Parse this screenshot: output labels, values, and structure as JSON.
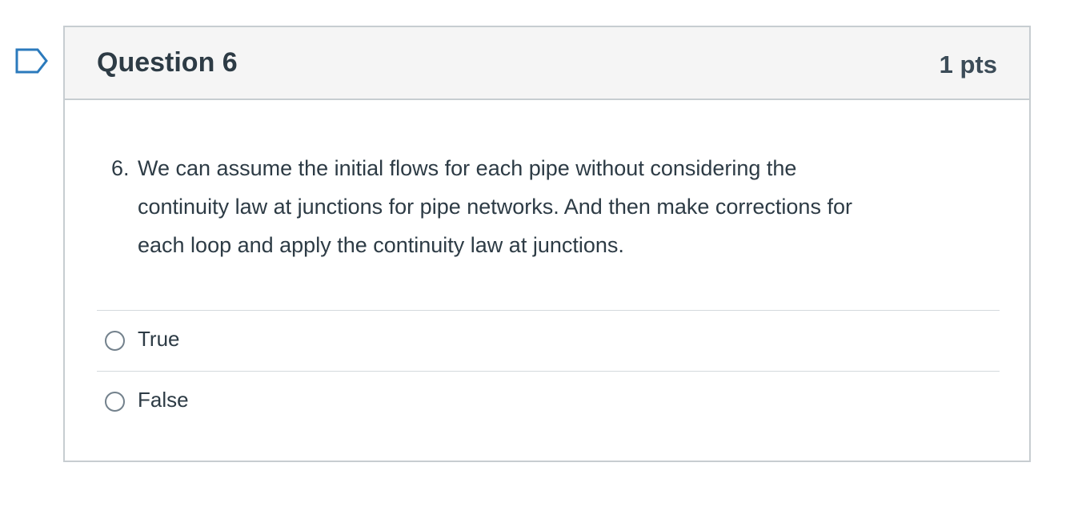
{
  "icons": {
    "flag": "bookmark-flag-icon",
    "radio": "radio-button-icon"
  },
  "colors": {
    "flag": "#2b7abc",
    "header_background": "#f5f5f5",
    "border": "#c7cdd1",
    "text": "#2d3b45"
  },
  "question": {
    "title": "Question 6",
    "points": "1 pts",
    "number": "6.",
    "text_lines": [
      "We can assume the initial flows for each pipe without considering the",
      "continuity law at junctions for pipe networks. And then make corrections for",
      "each loop and apply the continuity law at junctions."
    ]
  },
  "answers": [
    {
      "label": "True",
      "selected": false
    },
    {
      "label": "False",
      "selected": false
    }
  ]
}
